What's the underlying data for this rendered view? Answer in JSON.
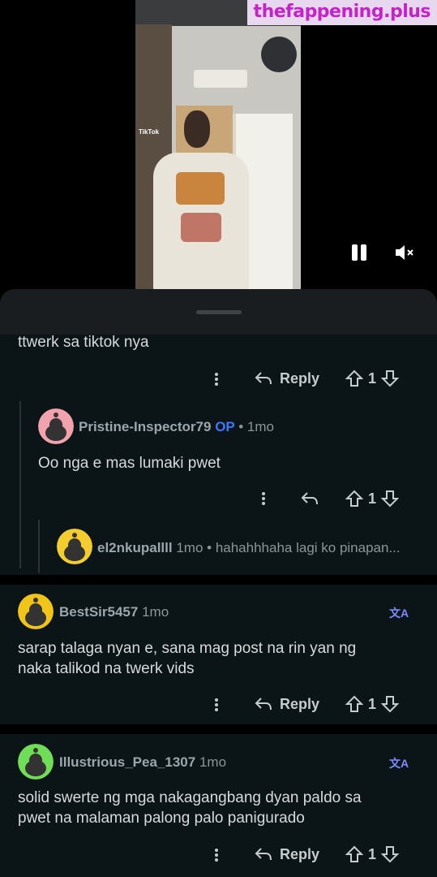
{
  "video": {
    "tiktok_label": "TikTok",
    "watermark": "thefappening.plus",
    "pause_icon": "pause-icon",
    "mute_icon": "mute-icon"
  },
  "thread": {
    "partial_comment": {
      "text": "ttwerk sa tiktok nya",
      "reply_label": "Reply",
      "votes": "1"
    },
    "reply1": {
      "username": "Pristine-Inspector79",
      "op_badge": "OP",
      "separator": "•",
      "time": "1mo",
      "text": "Oo nga e mas lumaki pwet",
      "votes": "1",
      "avatar_color": "#f2a2ad"
    },
    "reply2": {
      "username": "el2nkupallll",
      "time": "1mo",
      "preview": "• hahahhhaha lagi ko pinapan...",
      "avatar_color": "#f5cc2e"
    },
    "comment1": {
      "username": "BestSir5457",
      "time": "1mo",
      "text_line1": "sarap talaga nyan e, sana mag post na rin yan ng",
      "text_line2": "naka talikod na twerk vids",
      "reply_label": "Reply",
      "votes": "1",
      "avatar_color": "#f0c419"
    },
    "comment2": {
      "username": "Illustrious_Pea_1307",
      "time": "1mo",
      "text_line1": "solid swerte ng mga nakagangbang dyan paldo sa",
      "text_line2": "pwet na malaman palong palo panigurado",
      "reply_label": "Reply",
      "votes": "1",
      "avatar_color": "#6fdd57"
    }
  }
}
